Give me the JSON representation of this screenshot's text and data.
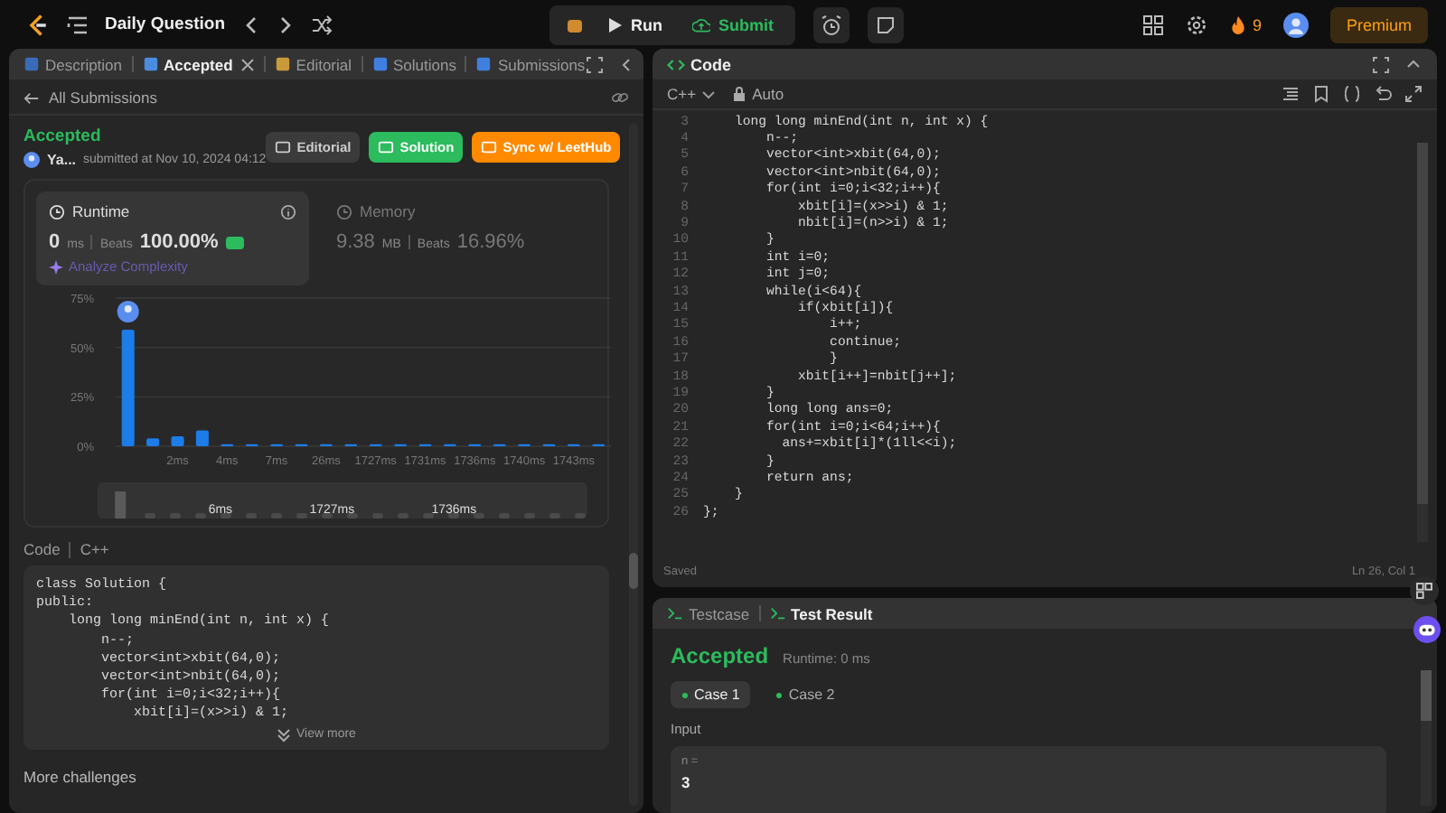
{
  "top_bar": {
    "title": "Daily Question",
    "run": "Run",
    "submit": "Submit",
    "streak": "9",
    "premium": "Premium"
  },
  "left_tabs": [
    {
      "label": "Description",
      "selected": false,
      "closable": false
    },
    {
      "label": "Accepted",
      "selected": true,
      "closable": true
    },
    {
      "label": "Editorial",
      "selected": false,
      "closable": false
    },
    {
      "label": "Solutions",
      "selected": false,
      "closable": false
    },
    {
      "label": "Submissions",
      "selected": false,
      "closable": false
    }
  ],
  "back_link": "All Submissions",
  "submission": {
    "status": "Accepted",
    "user": "Ya...",
    "submitted": "submitted at Nov 10, 2024 04:12",
    "buttons": [
      {
        "label": "Editorial",
        "kind": "neutral"
      },
      {
        "label": "Solution",
        "kind": "green"
      },
      {
        "label": "Sync w/ LeetHub",
        "kind": "orange"
      }
    ]
  },
  "metrics": [
    {
      "title": "Runtime",
      "value": "0",
      "unit": "ms",
      "beats_label": "Beats",
      "beats": "100.00%",
      "selected": true,
      "analyze": "Analyze Complexity"
    },
    {
      "title": "Memory",
      "value": "9.38",
      "unit": "MB",
      "beats_label": "Beats",
      "beats": "16.96%",
      "selected": false
    }
  ],
  "chart": {
    "chart_data": {
      "type": "bar",
      "categories": [
        null,
        null,
        "2ms",
        null,
        "4ms",
        null,
        "7ms",
        null,
        "26ms",
        null,
        "1727ms",
        null,
        "1731ms",
        null,
        "1736ms",
        null,
        "1740ms",
        null,
        "1743ms",
        null
      ],
      "values": [
        59,
        4,
        5,
        8,
        1,
        1,
        1,
        1,
        1,
        1,
        1,
        1,
        1,
        1,
        1,
        1,
        1,
        1,
        1,
        1
      ],
      "ylim": [
        0,
        75
      ],
      "yticks": [
        {
          "value": 0,
          "label": "0%"
        },
        {
          "value": 25,
          "label": "25%"
        },
        {
          "value": 50,
          "label": "50%"
        },
        {
          "value": 75,
          "label": "75%"
        }
      ]
    },
    "brush_labels": [
      "6ms",
      "1727ms",
      "1736ms"
    ],
    "brush": {
      "level": 0.02
    }
  },
  "code_preview": {
    "label": "Code",
    "language": "C++",
    "view_more": "View more",
    "lines": [
      "class Solution {",
      "public:",
      "    long long minEnd(int n, int x) {",
      "        n--;",
      "        vector<int>xbit(64,0);",
      "        vector<int>nbit(64,0);",
      "        for(int i=0;i<32;i++){",
      "            xbit[i]=(x>>i) & 1;"
    ]
  },
  "more_challenges": "More challenges",
  "editor": {
    "title": "Code",
    "language": "C++",
    "mode": "Auto",
    "status": "Saved",
    "cursor": "Ln 26, Col 1",
    "lines": [
      {
        "number": "3",
        "text": "    long long minEnd(int n, int x) {"
      },
      {
        "number": "4",
        "text": "        n--;"
      },
      {
        "number": "5",
        "text": "        vector<int>xbit(64,0);"
      },
      {
        "number": "6",
        "text": "        vector<int>nbit(64,0);"
      },
      {
        "number": "7",
        "text": "        for(int i=0;i<32;i++){"
      },
      {
        "number": "8",
        "text": "            xbit[i]=(x>>i) & 1;"
      },
      {
        "number": "9",
        "text": "            nbit[i]=(n>>i) & 1;"
      },
      {
        "number": "10",
        "text": "        }"
      },
      {
        "number": "11",
        "text": "        int i=0;"
      },
      {
        "number": "12",
        "text": "        int j=0;"
      },
      {
        "number": "13",
        "text": "        while(i<64){"
      },
      {
        "number": "14",
        "text": "            if(xbit[i]){"
      },
      {
        "number": "15",
        "text": "                i++;"
      },
      {
        "number": "16",
        "text": "                continue;"
      },
      {
        "number": "17",
        "text": "                }"
      },
      {
        "number": "18",
        "text": "            xbit[i++]=nbit[j++];"
      },
      {
        "number": "19",
        "text": "        }"
      },
      {
        "number": "20",
        "text": "        long long ans=0;"
      },
      {
        "number": "21",
        "text": "        for(int i=0;i<64;i++){"
      },
      {
        "number": "22",
        "text": "          ans+=xbit[i]*(1ll<<i);"
      },
      {
        "number": "23",
        "text": "        }"
      },
      {
        "number": "24",
        "text": "        return ans;"
      },
      {
        "number": "25",
        "text": "    }"
      },
      {
        "number": "26",
        "text": "};"
      }
    ]
  },
  "result_panel": {
    "tabs": [
      {
        "label": "Testcase",
        "selected": false
      },
      {
        "label": "Test Result",
        "selected": true
      }
    ],
    "status": "Accepted",
    "runtime": "Runtime: 0 ms",
    "cases": [
      {
        "label": "Case 1",
        "selected": true
      },
      {
        "label": "Case 2",
        "selected": false
      }
    ],
    "input_label": "Input",
    "input_name": "n =",
    "input_value": "3"
  }
}
